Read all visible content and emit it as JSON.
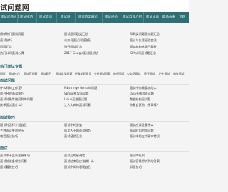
{
  "header": {
    "logo": "试问题网"
  },
  "nav": [
    "面试问题大全",
    "面试技巧",
    "面试官问",
    "面试题",
    "面试答案解析",
    "面试经验",
    "面试自我介绍",
    "面试文章",
    "职场故事",
    "专题"
  ],
  "sections": [
    {
      "title": "",
      "links": [
        "最新热门面试问题",
        "面试题问题类汇总",
        "印刷类问题面试题汇总",
        "面试技巧",
        "公务员面试问题答疑",
        "面试与生活经验交流",
        "问题汇总",
        "银行面试汇总",
        "面试结构化题目解析",
        "热门公司面试心得",
        "2017 Google面试题总结",
        "IBM公司面试题汇总"
      ]
    },
    {
      "title": "热门面试专题",
      "tags": [
        "面试",
        "面试技巧",
        "面试官问题",
        "面试题目",
        "面试常见问题",
        "行政助理面试",
        "会计面试问题",
        "教师面试",
        "公务员面试",
        "银行面试",
        "护士面试",
        "销售面试"
      ]
    },
    {
      "title": "面试问题",
      "links": [
        "什么样的工作室？",
        "Mbstringe domain问题",
        "面试中你最喜欢的人",
        "项目经理面试技巧",
        "Spring框架面试题",
        "Java多线程面试题",
        "面试时最常被问到的问题",
        "Linux运维面试题",
        "数据结构面试题",
        "技术面试面什么？",
        "让人头疼的面试问题",
        "你最自豪的一件事情？"
      ]
    },
    {
      "title": "面试技巧",
      "links": [
        "面试时怎样介绍自己",
        "面试中的坐姿",
        "面试应该注意什么",
        "三种面试失败经历",
        "成功人士的面试技巧",
        "面试时如何提问题",
        "电话面试技巧",
        "面试经验汇总",
        "面试中的三个致命错误"
      ]
    },
    {
      "title": "面试",
      "links": [
        "面试中十三条注意事项",
        "面试后的感谢信",
        "面试的礼仪",
        "面试前准备哪些问题",
        "面试结束后应该做什么",
        "面试官最想听到的答案",
        "面试着装技巧",
        "面试中如何表现自己",
        "群面技巧"
      ]
    }
  ]
}
